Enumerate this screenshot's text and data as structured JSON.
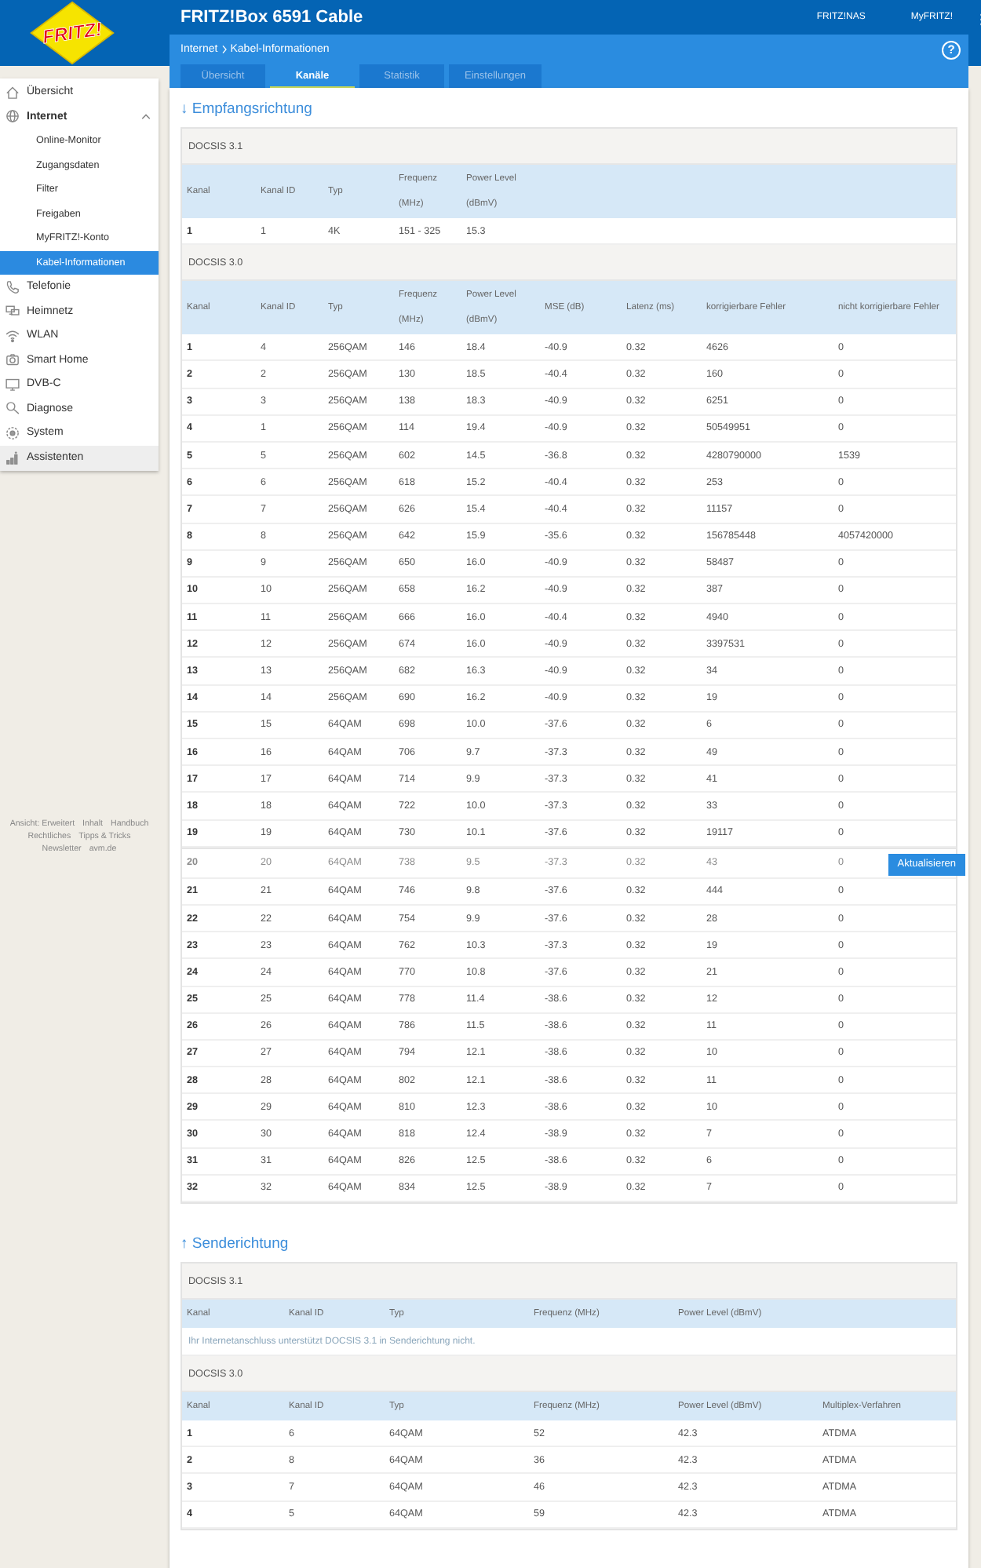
{
  "logo": {
    "text": "FRITZ!"
  },
  "header": {
    "title": "FRITZ!Box 6591 Cable",
    "links": [
      "FRITZ!NAS",
      "MyFRITZ!"
    ]
  },
  "breadcrumb": {
    "path": [
      "Internet",
      "Kabel-Informationen"
    ],
    "help": "?"
  },
  "tabs": [
    {
      "label": "Übersicht",
      "selected": false
    },
    {
      "label": "Kanäle",
      "selected": true
    },
    {
      "label": "Statistik",
      "selected": false
    },
    {
      "label": "Einstellungen",
      "selected": false
    }
  ],
  "sidebar": {
    "items": [
      {
        "label": "Übersicht"
      },
      {
        "label": "Internet",
        "expanded": true,
        "children": [
          {
            "label": "Online-Monitor",
            "selected": false
          },
          {
            "label": "Zugangsdaten",
            "selected": false
          },
          {
            "label": "Filter",
            "selected": false
          },
          {
            "label": "Freigaben",
            "selected": false
          },
          {
            "label": "MyFRITZ!-Konto",
            "selected": false
          },
          {
            "label": "Kabel-Informationen",
            "selected": true
          }
        ]
      },
      {
        "label": "Telefonie"
      },
      {
        "label": "Heimnetz"
      },
      {
        "label": "WLAN"
      },
      {
        "label": "Smart Home"
      },
      {
        "label": "DVB-C"
      },
      {
        "label": "Diagnose"
      },
      {
        "label": "System"
      }
    ],
    "assistant": "Assistenten"
  },
  "footer_links": [
    "Ansicht: Erweitert",
    "Inhalt",
    "Handbuch",
    "Rechtliches",
    "Tipps & Tricks",
    "Newsletter",
    "avm.de"
  ],
  "downstream": {
    "title": "↓ Empfangsrichtung",
    "sections": [
      {
        "title": "DOCSIS 3.1",
        "columns": [
          "Kanal",
          "Kanal ID",
          "Typ",
          "Frequenz\n(MHz)",
          "Power Level\n(dBmV)"
        ],
        "rows": [
          [
            "1",
            "1",
            "4K",
            "151 - 325",
            "15.3"
          ]
        ]
      },
      {
        "title": "DOCSIS 3.0",
        "columns": [
          "Kanal",
          "Kanal ID",
          "Typ",
          "Frequenz\n(MHz)",
          "Power Level\n(dBmV)",
          "MSE (dB)",
          "Latenz (ms)",
          "korrigierbare Fehler",
          "nicht korrigierbare Fehler"
        ],
        "rows": [
          [
            "1",
            "4",
            "256QAM",
            "146",
            "18.4",
            "-40.9",
            "0.32",
            "4626",
            "0"
          ],
          [
            "2",
            "2",
            "256QAM",
            "130",
            "18.5",
            "-40.4",
            "0.32",
            "160",
            "0"
          ],
          [
            "3",
            "3",
            "256QAM",
            "138",
            "18.3",
            "-40.9",
            "0.32",
            "6251",
            "0"
          ],
          [
            "4",
            "1",
            "256QAM",
            "114",
            "19.4",
            "-40.9",
            "0.32",
            "50549951",
            "0"
          ],
          [
            "5",
            "5",
            "256QAM",
            "602",
            "14.5",
            "-36.8",
            "0.32",
            "4280790000",
            "1539"
          ],
          [
            "6",
            "6",
            "256QAM",
            "618",
            "15.2",
            "-40.4",
            "0.32",
            "253",
            "0"
          ],
          [
            "7",
            "7",
            "256QAM",
            "626",
            "15.4",
            "-40.4",
            "0.32",
            "11157",
            "0"
          ],
          [
            "8",
            "8",
            "256QAM",
            "642",
            "15.9",
            "-35.6",
            "0.32",
            "156785448",
            "4057420000"
          ],
          [
            "9",
            "9",
            "256QAM",
            "650",
            "16.0",
            "-40.9",
            "0.32",
            "58487",
            "0"
          ],
          [
            "10",
            "10",
            "256QAM",
            "658",
            "16.2",
            "-40.9",
            "0.32",
            "387",
            "0"
          ],
          [
            "11",
            "11",
            "256QAM",
            "666",
            "16.0",
            "-40.4",
            "0.32",
            "4940",
            "0"
          ],
          [
            "12",
            "12",
            "256QAM",
            "674",
            "16.0",
            "-40.9",
            "0.32",
            "3397531",
            "0"
          ],
          [
            "13",
            "13",
            "256QAM",
            "682",
            "16.3",
            "-40.9",
            "0.32",
            "34",
            "0"
          ],
          [
            "14",
            "14",
            "256QAM",
            "690",
            "16.2",
            "-40.9",
            "0.32",
            "19",
            "0"
          ],
          [
            "15",
            "15",
            "64QAM",
            "698",
            "10.0",
            "-37.6",
            "0.32",
            "6",
            "0"
          ],
          [
            "16",
            "16",
            "64QAM",
            "706",
            "9.7",
            "-37.3",
            "0.32",
            "49",
            "0"
          ],
          [
            "17",
            "17",
            "64QAM",
            "714",
            "9.9",
            "-37.3",
            "0.32",
            "41",
            "0"
          ],
          [
            "18",
            "18",
            "64QAM",
            "722",
            "10.0",
            "-37.3",
            "0.32",
            "33",
            "0"
          ],
          [
            "19",
            "19",
            "64QAM",
            "730",
            "10.1",
            "-37.6",
            "0.32",
            "19117",
            "0"
          ],
          [
            "20",
            "20",
            "64QAM",
            "738",
            "9.5",
            "-37.3",
            "0.32",
            "43",
            "0"
          ],
          [
            "21",
            "21",
            "64QAM",
            "746",
            "9.8",
            "-37.6",
            "0.32",
            "444",
            "0"
          ],
          [
            "22",
            "22",
            "64QAM",
            "754",
            "9.9",
            "-37.6",
            "0.32",
            "28",
            "0"
          ],
          [
            "23",
            "23",
            "64QAM",
            "762",
            "10.3",
            "-37.3",
            "0.32",
            "19",
            "0"
          ],
          [
            "24",
            "24",
            "64QAM",
            "770",
            "10.8",
            "-37.6",
            "0.32",
            "21",
            "0"
          ],
          [
            "25",
            "25",
            "64QAM",
            "778",
            "11.4",
            "-38.6",
            "0.32",
            "12",
            "0"
          ],
          [
            "26",
            "26",
            "64QAM",
            "786",
            "11.5",
            "-38.6",
            "0.32",
            "11",
            "0"
          ],
          [
            "27",
            "27",
            "64QAM",
            "794",
            "12.1",
            "-38.6",
            "0.32",
            "10",
            "0"
          ],
          [
            "28",
            "28",
            "64QAM",
            "802",
            "12.1",
            "-38.6",
            "0.32",
            "11",
            "0"
          ],
          [
            "29",
            "29",
            "64QAM",
            "810",
            "12.3",
            "-38.6",
            "0.32",
            "10",
            "0"
          ],
          [
            "30",
            "30",
            "64QAM",
            "818",
            "12.4",
            "-38.9",
            "0.32",
            "7",
            "0"
          ],
          [
            "31",
            "31",
            "64QAM",
            "826",
            "12.5",
            "-38.6",
            "0.32",
            "6",
            "0"
          ],
          [
            "32",
            "32",
            "64QAM",
            "834",
            "12.5",
            "-38.9",
            "0.32",
            "7",
            "0"
          ]
        ]
      }
    ]
  },
  "upstream": {
    "title": "↑ Senderichtung",
    "sections": [
      {
        "title": "DOCSIS 3.1",
        "columns": [
          "Kanal",
          "Kanal ID",
          "Typ",
          "Frequenz (MHz)",
          "Power Level (dBmV)"
        ],
        "message": "Ihr Internetanschluss unterstützt DOCSIS 3.1 in Senderichtung nicht."
      },
      {
        "title": "DOCSIS 3.0",
        "columns": [
          "Kanal",
          "Kanal ID",
          "Typ",
          "Frequenz (MHz)",
          "Power Level (dBmV)",
          "Multiplex-Verfahren"
        ],
        "rows": [
          [
            "1",
            "6",
            "64QAM",
            "52",
            "42.3",
            "ATDMA"
          ],
          [
            "2",
            "8",
            "64QAM",
            "36",
            "42.3",
            "ATDMA"
          ],
          [
            "3",
            "7",
            "64QAM",
            "46",
            "42.3",
            "ATDMA"
          ],
          [
            "4",
            "5",
            "64QAM",
            "59",
            "42.3",
            "ATDMA"
          ]
        ]
      }
    ]
  },
  "action_bar": {
    "button": "Aktualisieren"
  }
}
